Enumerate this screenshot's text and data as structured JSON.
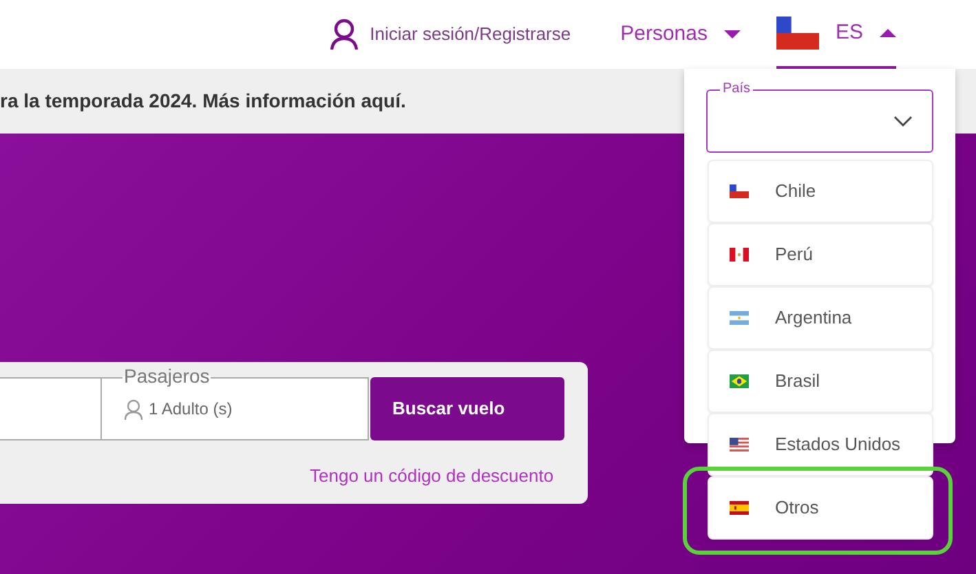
{
  "header": {
    "login": "Iniciar sesión/Registrarse",
    "segment": {
      "label": "Personas"
    },
    "language": {
      "label": "ES",
      "expanded": true,
      "flag": {
        "kind": "chile"
      }
    }
  },
  "banner": {
    "text": "ra la temporada 2024. Más información aquí."
  },
  "search": {
    "passengers": {
      "label": "Pasajeros",
      "value": "1 Adulto (s)"
    },
    "button": "Buscar vuelo",
    "discount_link": "Tengo un código de descuento"
  },
  "country_menu": {
    "field_label": "País",
    "items": [
      {
        "label": "Chile",
        "kind": "chile",
        "highlighted": false
      },
      {
        "label": "Perú",
        "kind": "peru",
        "highlighted": false
      },
      {
        "label": "Argentina",
        "kind": "argentina",
        "highlighted": false
      },
      {
        "label": "Brasil",
        "kind": "brasil",
        "highlighted": false
      },
      {
        "label": "Estados Unidos",
        "kind": "usa",
        "highlighted": false
      },
      {
        "label": "Otros",
        "kind": "spain",
        "highlighted": true
      }
    ]
  }
}
